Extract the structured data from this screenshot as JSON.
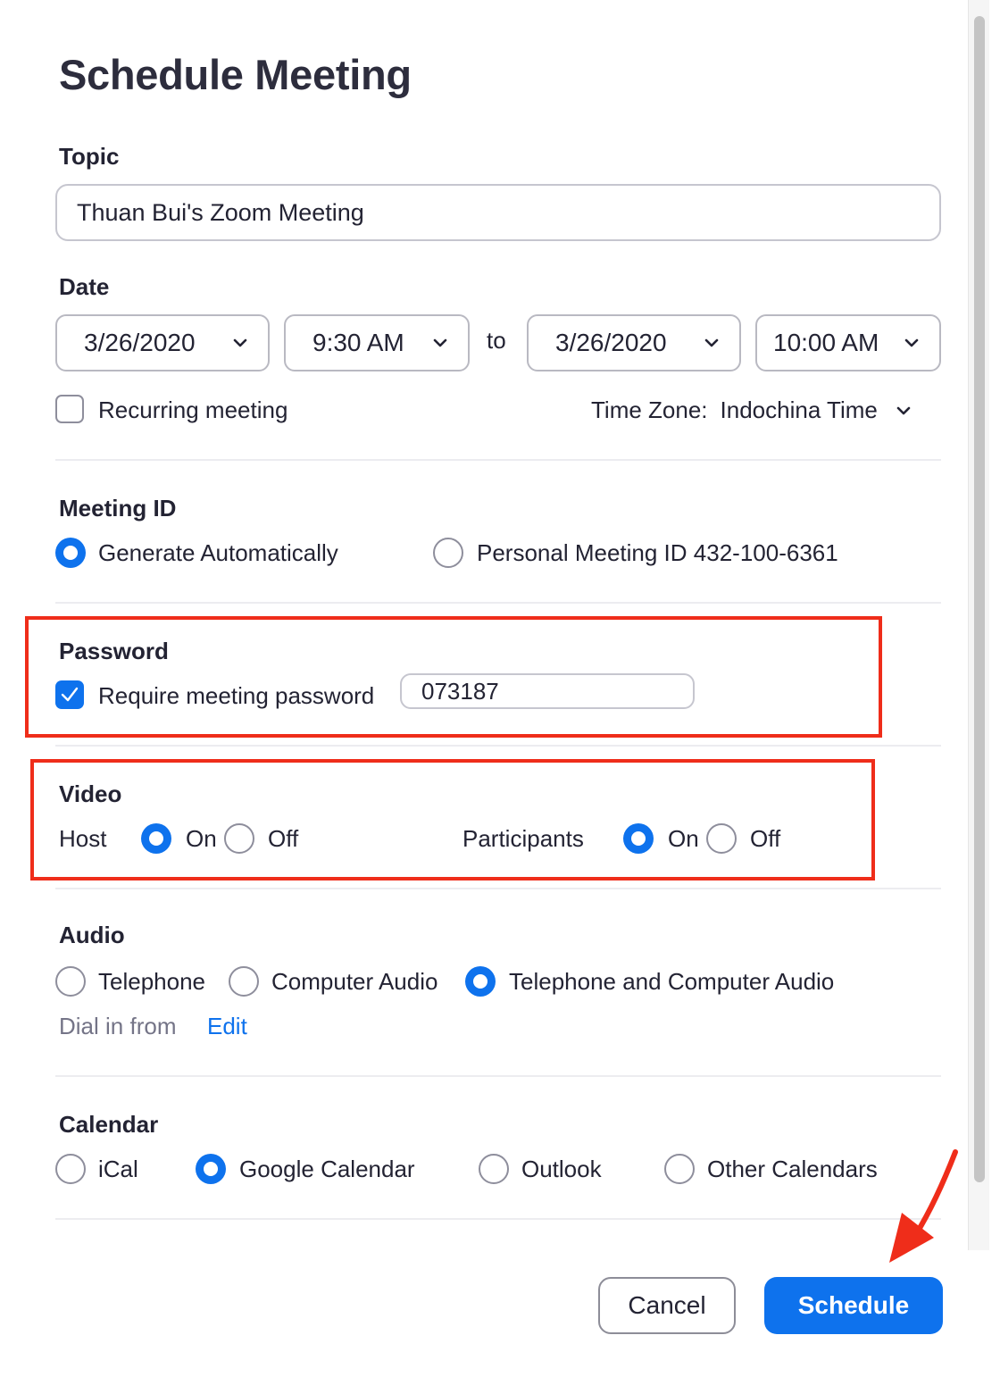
{
  "dialog": {
    "title": "Schedule Meeting"
  },
  "topic": {
    "label": "Topic",
    "value": "Thuan Bui's Zoom Meeting"
  },
  "date": {
    "label": "Date",
    "start_date": "3/26/2020",
    "start_time": "9:30 AM",
    "to_label": "to",
    "end_date": "3/26/2020",
    "end_time": "10:00 AM",
    "recurring_label": "Recurring meeting",
    "recurring_checked": false,
    "timezone_prefix": "Time Zone:",
    "timezone_value": "Indochina Time"
  },
  "meeting_id": {
    "label": "Meeting ID",
    "options": [
      {
        "label": "Generate Automatically",
        "selected": true
      },
      {
        "label": "Personal Meeting ID 432-100-6361",
        "selected": false
      }
    ]
  },
  "password": {
    "label": "Password",
    "require_label": "Require meeting password",
    "require_checked": true,
    "value": "073187"
  },
  "video": {
    "label": "Video",
    "host_label": "Host",
    "participants_label": "Participants",
    "on_label": "On",
    "off_label": "Off",
    "host_on": true,
    "participants_on": true
  },
  "audio": {
    "label": "Audio",
    "options": [
      {
        "label": "Telephone",
        "selected": false
      },
      {
        "label": "Computer Audio",
        "selected": false
      },
      {
        "label": "Telephone and Computer Audio",
        "selected": true
      }
    ],
    "dial_in_label": "Dial in from",
    "edit_label": "Edit"
  },
  "calendar": {
    "label": "Calendar",
    "options": [
      {
        "label": "iCal",
        "selected": false
      },
      {
        "label": "Google Calendar",
        "selected": true
      },
      {
        "label": "Outlook",
        "selected": false
      },
      {
        "label": "Other Calendars",
        "selected": false
      }
    ]
  },
  "footer": {
    "cancel_label": "Cancel",
    "schedule_label": "Schedule"
  },
  "colors": {
    "accent": "#0e72ed",
    "highlight": "#ef2d1a"
  }
}
